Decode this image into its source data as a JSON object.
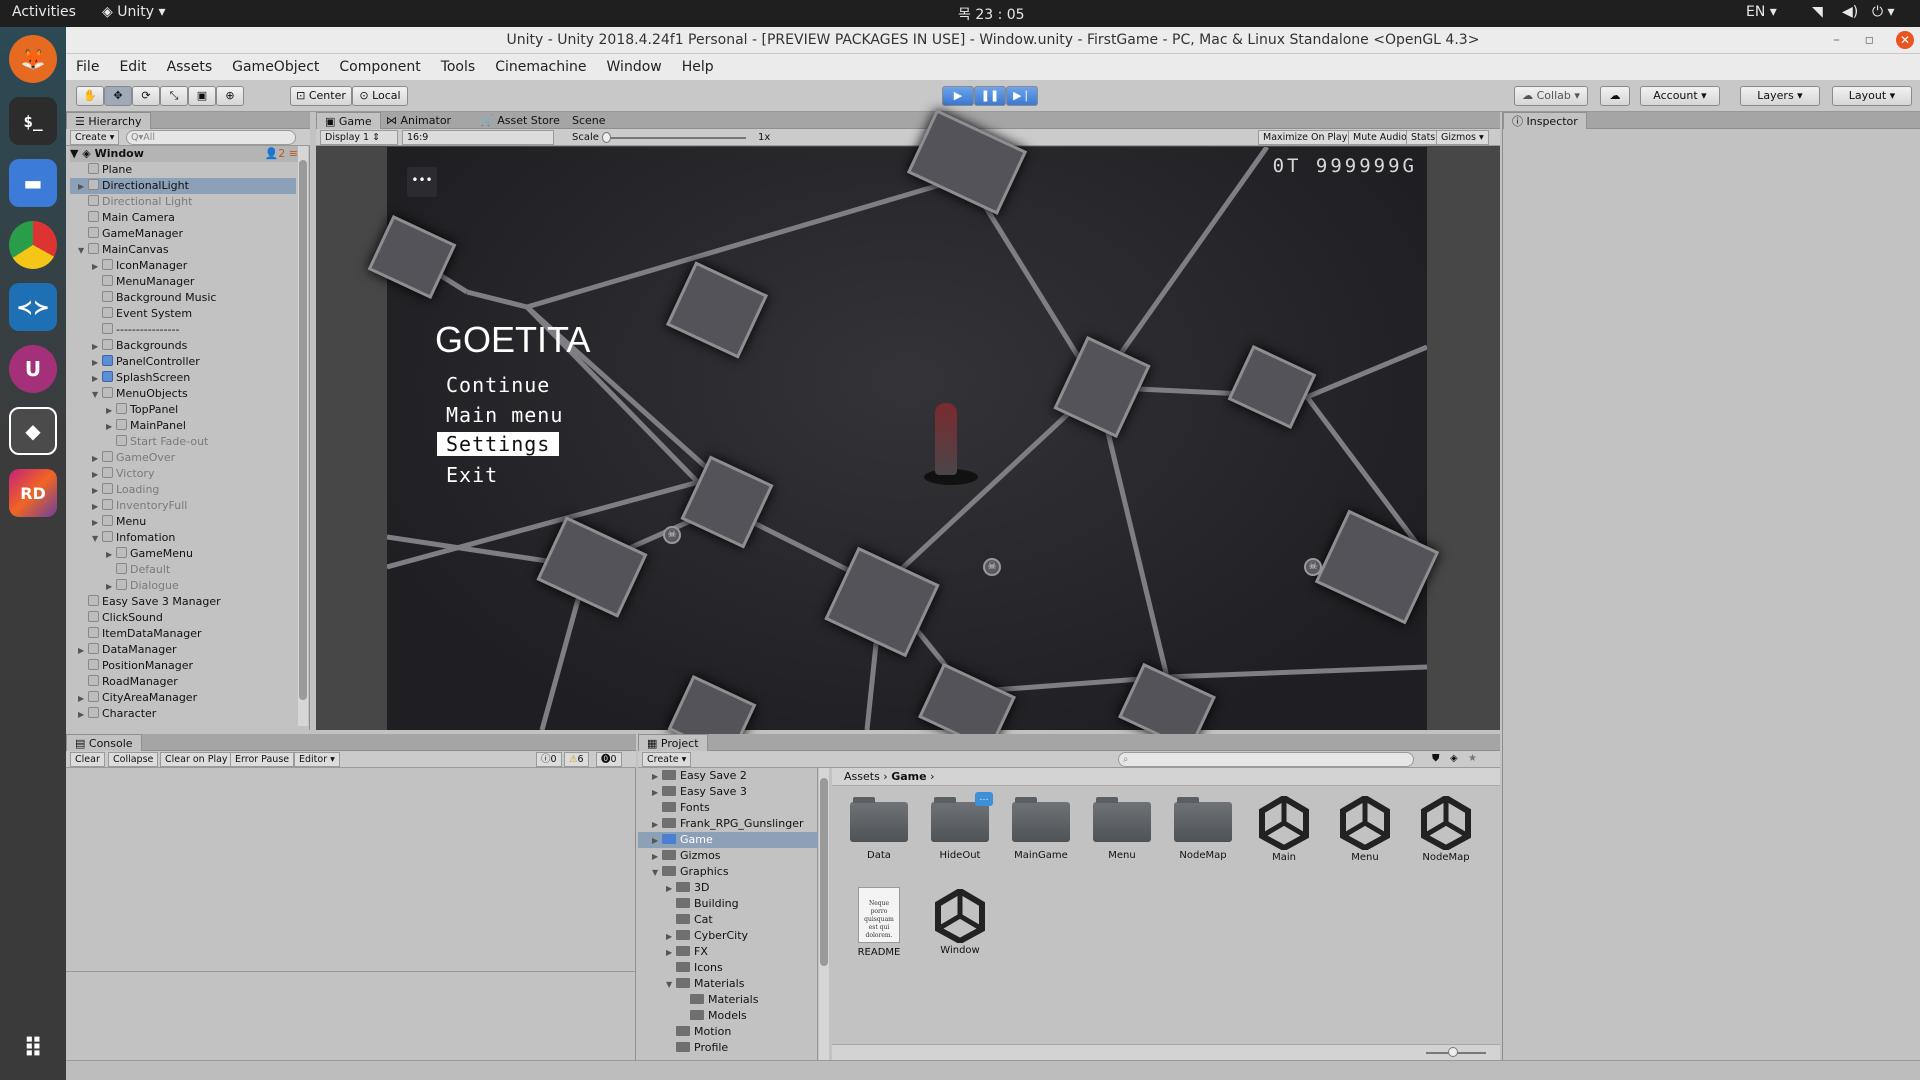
{
  "topbar": {
    "activities": "Activities",
    "app": "Unity",
    "clock": "목 23 : 05",
    "lang": "EN"
  },
  "window_title": "Unity - Unity 2018.4.24f1 Personal - [PREVIEW PACKAGES IN USE] - Window.unity - FirstGame - PC, Mac & Linux Standalone <OpenGL 4.3>",
  "menu": [
    "File",
    "Edit",
    "Assets",
    "GameObject",
    "Component",
    "Tools",
    "Cinemachine",
    "Window",
    "Help"
  ],
  "toolbar": {
    "center": "Center",
    "local": "Local",
    "collab": "Collab",
    "account": "Account",
    "layers": "Layers",
    "layout": "Layout"
  },
  "hierarchy": {
    "tab": "Hierarchy",
    "create": "Create",
    "search_placeholder": "Q▾All",
    "scene": "Window",
    "scene_count": "2",
    "items": [
      {
        "label": "Plane",
        "indent": 0,
        "arrow": "",
        "dim": false,
        "sel": false
      },
      {
        "label": "DirectionalLight",
        "indent": 0,
        "arrow": "▶",
        "dim": false,
        "sel": true
      },
      {
        "label": "Directional Light",
        "indent": 0,
        "arrow": "",
        "dim": true,
        "sel": false
      },
      {
        "label": "Main Camera",
        "indent": 0,
        "arrow": "",
        "dim": false,
        "sel": false
      },
      {
        "label": "GameManager",
        "indent": 0,
        "arrow": "",
        "dim": false,
        "sel": false
      },
      {
        "label": "MainCanvas",
        "indent": 0,
        "arrow": "▼",
        "dim": false,
        "sel": false
      },
      {
        "label": "IconManager",
        "indent": 1,
        "arrow": "▶",
        "dim": false,
        "sel": false
      },
      {
        "label": "MenuManager",
        "indent": 1,
        "arrow": "",
        "dim": false,
        "sel": false
      },
      {
        "label": "Background Music",
        "indent": 1,
        "arrow": "",
        "dim": false,
        "sel": false
      },
      {
        "label": "Event System",
        "indent": 1,
        "arrow": "",
        "dim": false,
        "sel": false
      },
      {
        "label": "----------------",
        "indent": 1,
        "arrow": "",
        "dim": false,
        "sel": false
      },
      {
        "label": "Backgrounds",
        "indent": 1,
        "arrow": "▶",
        "dim": false,
        "sel": false
      },
      {
        "label": "PanelController",
        "indent": 1,
        "arrow": "▶",
        "dim": false,
        "sel": false,
        "blue": true
      },
      {
        "label": "SplashScreen",
        "indent": 1,
        "arrow": "▶",
        "dim": false,
        "sel": false,
        "blue": true
      },
      {
        "label": "MenuObjects",
        "indent": 1,
        "arrow": "▼",
        "dim": false,
        "sel": false
      },
      {
        "label": "TopPanel",
        "indent": 2,
        "arrow": "▶",
        "dim": false,
        "sel": false
      },
      {
        "label": "MainPanel",
        "indent": 2,
        "arrow": "▶",
        "dim": false,
        "sel": false
      },
      {
        "label": "Start Fade-out",
        "indent": 2,
        "arrow": "",
        "dim": true,
        "sel": false
      },
      {
        "label": "GameOver",
        "indent": 1,
        "arrow": "▶",
        "dim": true,
        "sel": false
      },
      {
        "label": "Victory",
        "indent": 1,
        "arrow": "▶",
        "dim": true,
        "sel": false
      },
      {
        "label": "Loading",
        "indent": 1,
        "arrow": "▶",
        "dim": true,
        "sel": false
      },
      {
        "label": "InventoryFull",
        "indent": 1,
        "arrow": "▶",
        "dim": true,
        "sel": false
      },
      {
        "label": "Menu",
        "indent": 1,
        "arrow": "▶",
        "dim": false,
        "sel": false
      },
      {
        "label": "Infomation",
        "indent": 1,
        "arrow": "▼",
        "dim": false,
        "sel": false
      },
      {
        "label": "GameMenu",
        "indent": 2,
        "arrow": "▶",
        "dim": false,
        "sel": false
      },
      {
        "label": "Default",
        "indent": 2,
        "arrow": "",
        "dim": true,
        "sel": false
      },
      {
        "label": "Dialogue",
        "indent": 2,
        "arrow": "▶",
        "dim": true,
        "sel": false
      },
      {
        "label": "Easy Save 3 Manager",
        "indent": 0,
        "arrow": "",
        "dim": false,
        "sel": false
      },
      {
        "label": "ClickSound",
        "indent": 0,
        "arrow": "",
        "dim": false,
        "sel": false
      },
      {
        "label": "ItemDataManager",
        "indent": 0,
        "arrow": "",
        "dim": false,
        "sel": false
      },
      {
        "label": "DataManager",
        "indent": 0,
        "arrow": "▶",
        "dim": false,
        "sel": false
      },
      {
        "label": "PositionManager",
        "indent": 0,
        "arrow": "",
        "dim": false,
        "sel": false
      },
      {
        "label": "RoadManager",
        "indent": 0,
        "arrow": "",
        "dim": false,
        "sel": false
      },
      {
        "label": "CityAreaManager",
        "indent": 0,
        "arrow": "▶",
        "dim": false,
        "sel": false
      },
      {
        "label": "Character",
        "indent": 0,
        "arrow": "▶",
        "dim": false,
        "sel": false
      }
    ]
  },
  "game_view": {
    "tabs": [
      "Game",
      "Animator",
      "Asset Store",
      "Scene"
    ],
    "display": "Display 1",
    "aspect": "16:9",
    "scale_label": "Scale",
    "scale_value": "1x",
    "options": [
      "Maximize On Play",
      "Mute Audio",
      "Stats",
      "Gizmos"
    ],
    "hud": "0T  999999G",
    "dots": "•••",
    "game_title": "GOETITA",
    "menu_items": [
      "Continue",
      "Main menu",
      "Settings",
      "Exit"
    ],
    "selected_index": 2
  },
  "inspector": {
    "tab": "Inspector"
  },
  "console": {
    "tab": "Console",
    "buttons": [
      "Clear",
      "Collapse",
      "Clear on Play",
      "Error Pause",
      "Editor"
    ],
    "counts": [
      "0",
      "6",
      "0"
    ]
  },
  "project": {
    "tab": "Project",
    "create": "Create",
    "breadcrumb": [
      "Assets",
      "Game"
    ],
    "tree": [
      {
        "label": "Easy Save 2",
        "indent": 0,
        "arrow": "▶"
      },
      {
        "label": "Easy Save 3",
        "indent": 0,
        "arrow": "▶"
      },
      {
        "label": "Fonts",
        "indent": 0,
        "arrow": ""
      },
      {
        "label": "Frank_RPG_Gunslinger",
        "indent": 0,
        "arrow": "▶"
      },
      {
        "label": "Game",
        "indent": 0,
        "arrow": "▶",
        "sel": true
      },
      {
        "label": "Gizmos",
        "indent": 0,
        "arrow": "▶"
      },
      {
        "label": "Graphics",
        "indent": 0,
        "arrow": "▼"
      },
      {
        "label": "3D",
        "indent": 1,
        "arrow": "▶"
      },
      {
        "label": "Building",
        "indent": 1,
        "arrow": ""
      },
      {
        "label": "Cat",
        "indent": 1,
        "arrow": ""
      },
      {
        "label": "CyberCity",
        "indent": 1,
        "arrow": "▶"
      },
      {
        "label": "FX",
        "indent": 1,
        "arrow": "▶"
      },
      {
        "label": "Icons",
        "indent": 1,
        "arrow": ""
      },
      {
        "label": "Materials",
        "indent": 1,
        "arrow": "▼"
      },
      {
        "label": "Materials",
        "indent": 2,
        "arrow": ""
      },
      {
        "label": "Models",
        "indent": 2,
        "arrow": ""
      },
      {
        "label": "Motion",
        "indent": 1,
        "arrow": ""
      },
      {
        "label": "Profile",
        "indent": 1,
        "arrow": ""
      }
    ],
    "assets": [
      {
        "label": "Data",
        "kind": "folder"
      },
      {
        "label": "HideOut",
        "kind": "folder"
      },
      {
        "label": "MainGame",
        "kind": "folder"
      },
      {
        "label": "Menu",
        "kind": "folder"
      },
      {
        "label": "NodeMap",
        "kind": "folder"
      },
      {
        "label": "Main",
        "kind": "scene"
      },
      {
        "label": "Menu",
        "kind": "scene"
      },
      {
        "label": "NodeMap",
        "kind": "scene"
      },
      {
        "label": "README",
        "kind": "doc"
      },
      {
        "label": "Window",
        "kind": "scene"
      }
    ],
    "readme_preview": "Neque porro quisquam est qui dolorem."
  },
  "colors": {
    "selection": "#8ca0b8",
    "play_active": "#4a86d8",
    "game_bg": "#262529"
  }
}
